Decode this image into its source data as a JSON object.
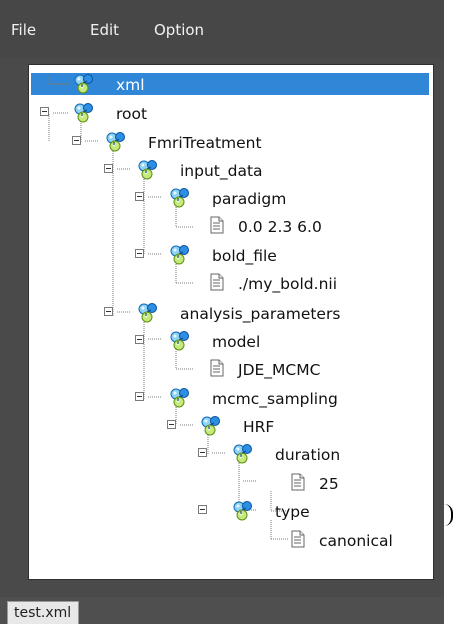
{
  "menubar": {
    "items": [
      {
        "label": "File"
      },
      {
        "label": "Edit"
      },
      {
        "label": "Option"
      }
    ]
  },
  "colors": {
    "background": "#4a4a4a",
    "tree_background": "#ffffff",
    "selection": "#3087d8",
    "text": "#111111",
    "selected_text": "#ffffff"
  },
  "tree": {
    "nodes": [
      {
        "label": "xml",
        "icon": "molecule-icon",
        "selected": true
      },
      {
        "label": "root",
        "icon": "molecule-icon",
        "expanded": true
      },
      {
        "label": "FmriTreatment",
        "icon": "molecule-icon",
        "expanded": true
      },
      {
        "label": "input_data",
        "icon": "molecule-icon",
        "expanded": true
      },
      {
        "label": "paradigm",
        "icon": "molecule-icon",
        "expanded": true
      },
      {
        "label": "0.0 2.3 6.0",
        "icon": "document-icon"
      },
      {
        "label": "bold_file",
        "icon": "molecule-icon",
        "expanded": true
      },
      {
        "label": "./my_bold.nii",
        "icon": "document-icon"
      },
      {
        "label": "analysis_parameters",
        "icon": "molecule-icon",
        "expanded": true
      },
      {
        "label": "model",
        "icon": "molecule-icon",
        "expanded": true
      },
      {
        "label": "JDE_MCMC",
        "icon": "document-icon"
      },
      {
        "label": "mcmc_sampling",
        "icon": "molecule-icon",
        "expanded": true
      },
      {
        "label": "HRF",
        "icon": "molecule-icon",
        "expanded": true
      },
      {
        "label": "duration",
        "icon": "molecule-icon",
        "expanded": true
      },
      {
        "label": "25",
        "icon": "document-icon"
      },
      {
        "label": "type",
        "icon": "molecule-icon",
        "expanded": true
      },
      {
        "label": "canonical",
        "icon": "document-icon"
      }
    ]
  },
  "status": {
    "file_tab": "test.xml"
  }
}
